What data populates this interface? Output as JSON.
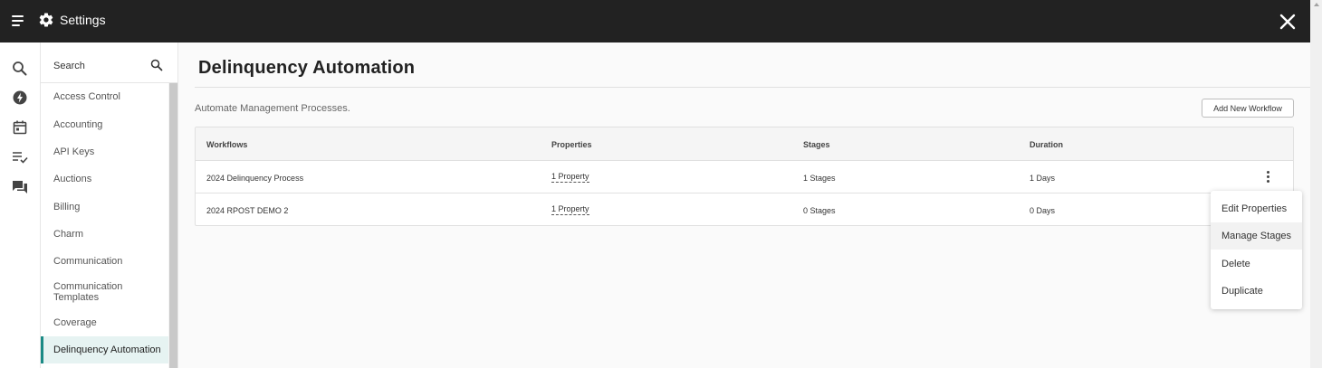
{
  "topbar": {
    "title": "Settings",
    "icons": {
      "menu": "hamburger-menu-icon",
      "app": "gear-icon",
      "close": "close-icon"
    }
  },
  "rail": {
    "icons": [
      "search-icon",
      "bolt-icon",
      "calendar-icon",
      "checklist-icon",
      "chat-icon"
    ]
  },
  "nav": {
    "search_label": "Search",
    "items": [
      {
        "label": "Access Control"
      },
      {
        "label": "Accounting"
      },
      {
        "label": "API Keys"
      },
      {
        "label": "Auctions"
      },
      {
        "label": "Billing"
      },
      {
        "label": "Charm"
      },
      {
        "label": "Communication"
      },
      {
        "label": "Communication Templates"
      },
      {
        "label": "Coverage"
      },
      {
        "label": "Delinquency Automation",
        "active": true
      }
    ]
  },
  "main": {
    "title": "Delinquency Automation",
    "subtitle": "Automate Management Processes.",
    "add_button": "Add New Workflow",
    "table": {
      "headers": [
        "Workflows",
        "Properties",
        "Stages",
        "Duration"
      ],
      "rows": [
        {
          "workflow": "2024 Delinquency Process",
          "properties": "1 Property",
          "stages": "1 Stages",
          "duration": "1 Days"
        },
        {
          "workflow": "2024 RPOST DEMO 2",
          "properties": "1 Property",
          "stages": "0 Stages",
          "duration": "0 Days"
        }
      ]
    }
  },
  "context_menu": {
    "items": [
      "Edit Properties",
      "Manage Stages",
      "Delete",
      "Duplicate"
    ],
    "highlighted": "Manage Stages"
  },
  "colors": {
    "topbar": "#222222",
    "accent": "#1a8a85",
    "active_bg": "#e6f3f2"
  }
}
